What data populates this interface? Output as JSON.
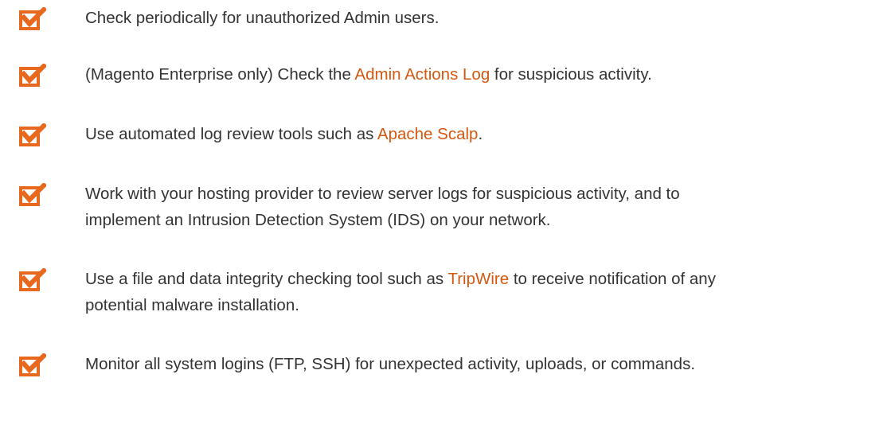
{
  "colors": {
    "text": "#333333",
    "link": "#d4580f",
    "icon": "#e8681e"
  },
  "icon_name": "checkbox-checked-icon",
  "items": [
    {
      "before": "Check periodically for unauthorized Admin users.",
      "link": "",
      "after": ""
    },
    {
      "before": "(Magento Enterprise only) Check the ",
      "link": "Admin Actions Log",
      "after": " for suspicious activity."
    },
    {
      "before": "Use automated log review tools such as ",
      "link": "Apache Scalp",
      "after": "."
    },
    {
      "line1": "Work with your hosting provider to review server logs for suspicious activity, and to",
      "line2": "implement an Intrusion Detection System (IDS) on your network."
    },
    {
      "before": "Use a file and data integrity checking tool such as ",
      "link": "TripWire",
      "after": " to receive notification of any",
      "line2": "potential malware installation."
    },
    {
      "before": "Monitor all system logins (FTP, SSH) for unexpected activity, uploads, or commands.",
      "link": "",
      "after": ""
    }
  ]
}
